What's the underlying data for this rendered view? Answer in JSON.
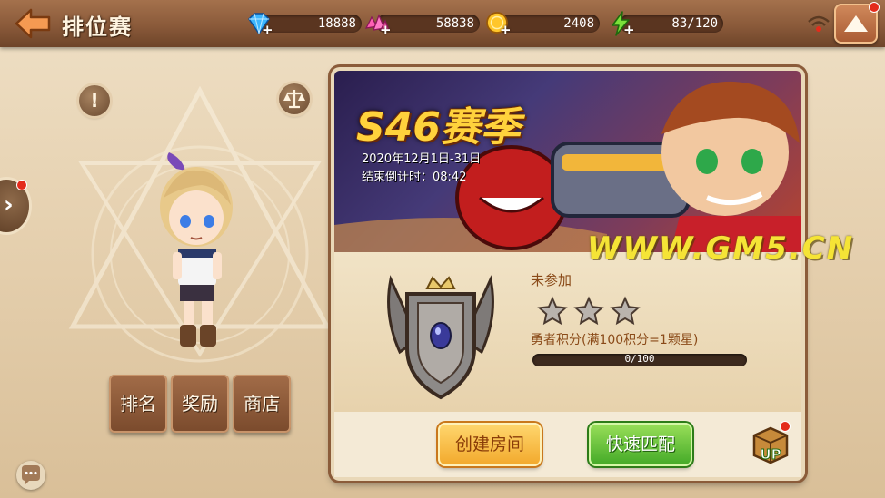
{
  "header": {
    "title": "排位赛",
    "resources": [
      {
        "name": "diamond-icon",
        "value": "18888"
      },
      {
        "name": "crystal-icon",
        "value": "58838"
      },
      {
        "name": "gold-coin-icon",
        "value": "2408"
      },
      {
        "name": "energy-icon",
        "value": "83/120"
      }
    ],
    "plus": "+"
  },
  "left": {
    "info_symbol": "!",
    "tabs": [
      "排名",
      "奖励",
      "商店"
    ]
  },
  "season": {
    "title": "S46赛季",
    "dates": "2020年12月1日-31日",
    "countdown": "结束倒计时：08:42"
  },
  "rank": {
    "status": "未参加",
    "stars_filled": 0,
    "stars_total": 3,
    "points_label": "勇者积分(满100积分=1颗星)",
    "progress_text": "0/100",
    "progress_value": 0
  },
  "actions": {
    "create_room": "创建房间",
    "quick_match": "快速匹配",
    "up_label": "UP"
  },
  "watermark": "WWW.GM5.CN",
  "colors": {
    "topbar": "#8a5a3a",
    "gold_text": "#ffd23c",
    "green_button": "#41a826",
    "orange_button": "#f2a82a"
  }
}
